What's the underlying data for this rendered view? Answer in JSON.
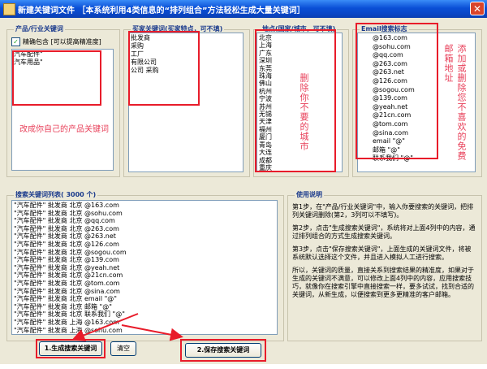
{
  "window": {
    "title": "新建关键词文件    ［本系统利用4类信息的“排列组合”方法轻松生成大量关键词］",
    "close_glyph": "✕"
  },
  "product_group": {
    "title": "产品/行业关键词",
    "checkbox_label": "精确包含 [可以提高精准度]",
    "checked_glyph": "✓",
    "items": [
      "汽车配件\"",
      "汽车用品\""
    ],
    "annotation": "改成你自己的产品关键词"
  },
  "buyer_group": {
    "title": "买家关键词(买家特点，可不填)",
    "items": [
      "批发商",
      "采购",
      "工厂",
      "有限公司",
      "公司 采购"
    ]
  },
  "location_group": {
    "title": "地点(国家/城市，可不填)",
    "items": [
      "北京",
      "上海",
      "广东",
      "深圳",
      "东莞",
      "珠海",
      "佛山",
      "杭州",
      "宁波",
      "苏州",
      "无锡",
      "天津",
      "福州",
      "厦门",
      "青岛",
      "大连",
      "成都",
      "重庆"
    ],
    "annotation": "删除你不要的城市"
  },
  "email_group": {
    "title": "Email搜索标志",
    "items": [
      "@163.com",
      "@sohu.com",
      "@qq.com",
      "@263.com",
      "@263.net",
      "@126.com",
      "@sogou.com",
      "@139.com",
      "@yeah.net",
      "@21cn.com",
      "@tom.com",
      "@sina.com",
      "email \"@\"",
      "邮箱 \"@\"",
      "联系我们 \"@\""
    ],
    "annotation": "添加或删除您不喜欢的免费邮箱地址"
  },
  "keyword_list": {
    "title": "搜索关键词列表( 3000 个)",
    "items": [
      "\"汽车配件\" 批发商 北京 @163.com",
      "\"汽车配件\" 批发商 北京 @sohu.com",
      "\"汽车配件\" 批发商 北京 @qq.com",
      "\"汽车配件\" 批发商 北京 @263.com",
      "\"汽车配件\" 批发商 北京 @263.net",
      "\"汽车配件\" 批发商 北京 @126.com",
      "\"汽车配件\" 批发商 北京 @sogou.com",
      "\"汽车配件\" 批发商 北京 @139.com",
      "\"汽车配件\" 批发商 北京 @yeah.net",
      "\"汽车配件\" 批发商 北京 @21cn.com",
      "\"汽车配件\" 批发商 北京 @tom.com",
      "\"汽车配件\" 批发商 北京 @sina.com",
      "\"汽车配件\" 批发商 北京 email \"@\"",
      "\"汽车配件\" 批发商 北京 邮箱 \"@\"",
      "\"汽车配件\" 批发商 北京 联系我们 \"@\"",
      "\"汽车配件\" 批发商 上海 @163.com",
      "\"汽车配件\" 批发商 上海 @sohu.com"
    ]
  },
  "usage": {
    "title": "使用说明",
    "paragraphs": [
      "第1步，在\"产品/行业关键词\"中，输入你要搜索的关键词，把排列关键词删除(第2，3列可以不填写)。",
      "第2步，点击\"生成搜索关键词\"，系统将对上面4列中的内容，通过排列组合的方式生成搜索关键词。",
      "第3步，点击\"保存搜索关键词\"，上面生成的关键词文件，将被系统默认选择这个文件，并且进入模拟人工进行搜索。",
      "所以，关键词的质量，直接关系到搜索结果的精准度，如果对于生成的关键词不满意，可以修改上面4列中的内容，应用搜索技巧，就像你在搜索引擎中直接搜索一样，要多试试，找到合适的关键词，从新生成，以便搜索到更多更精准的客户邮箱。"
    ]
  },
  "buttons": {
    "generate": "1.生成搜索关键词",
    "clear": "清空",
    "save": "2.保存搜索关键词"
  }
}
